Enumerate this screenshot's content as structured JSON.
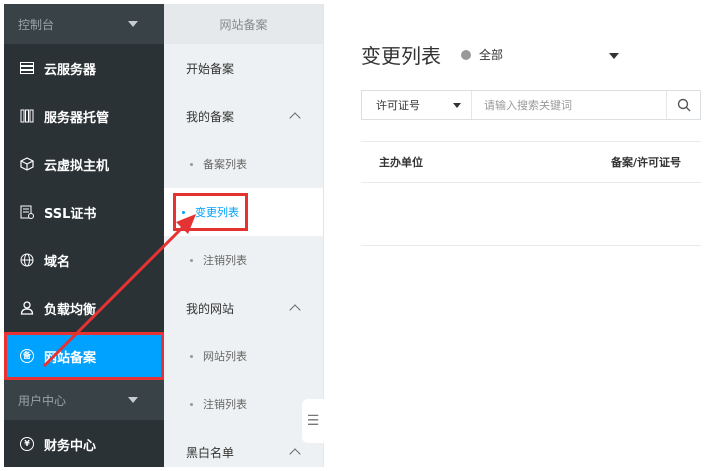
{
  "sidebar": {
    "section_console": "控制台",
    "section_user": "用户中心",
    "items": [
      {
        "label": "云服务器",
        "icon": "server-list-icon"
      },
      {
        "label": "服务器托管",
        "icon": "server-rack-icon"
      },
      {
        "label": "云虚拟主机",
        "icon": "cube-icon"
      },
      {
        "label": "SSL证书",
        "icon": "certificate-icon"
      },
      {
        "label": "域名",
        "icon": "globe-icon"
      },
      {
        "label": "负载均衡",
        "icon": "load-balance-icon"
      },
      {
        "label": "网站备案",
        "icon": "filing-badge-icon",
        "active": true
      },
      {
        "label": "财务中心",
        "icon": "yen-icon"
      }
    ],
    "active_icon_char": "备",
    "finance_icon_char": "¥"
  },
  "subnav": {
    "header": "网站备案",
    "start": "开始备案",
    "group_my_filing": "我的备案",
    "filing_list": "备案列表",
    "change_list": "变更列表",
    "cancel_list_1": "注销列表",
    "group_my_site": "我的网站",
    "site_list": "网站列表",
    "cancel_list_2": "注销列表",
    "group_blacklist": "黑白名单",
    "collapse_icon": "☰"
  },
  "main": {
    "title": "变更列表",
    "status_label": "全部",
    "search_type": "许可证号",
    "search_placeholder": "请输入搜索关键词",
    "columns": [
      "主办单位",
      "备案/许可证号"
    ]
  },
  "colors": {
    "sidebar_bg": "#2b3236",
    "active_blue": "#00a2ff",
    "highlight_red": "#e53333"
  }
}
